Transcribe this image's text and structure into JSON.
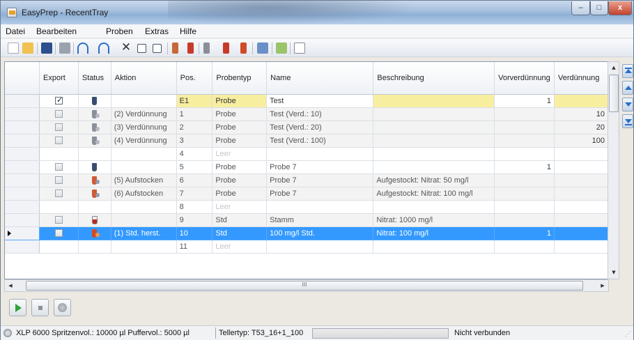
{
  "window": {
    "title": "EasyPrep - RecentTray",
    "min_label": "–",
    "max_label": "□",
    "close_label": "x"
  },
  "menu": [
    "Datei",
    "Bearbeiten",
    "Proben",
    "Extras",
    "Hilfe"
  ],
  "toolbar": {
    "icons": [
      "new-icon",
      "open-icon",
      "save-icon",
      "print-icon",
      "undo-icon",
      "redo-icon",
      "delete-icon",
      "check-all-icon",
      "uncheck-all-icon",
      "dilution-icon",
      "spike-icon",
      "dilution-dropdown-icon",
      "spike-dropdown-icon",
      "standard-icon",
      "table-icon",
      "import-icon",
      "list-icon"
    ]
  },
  "grid": {
    "columns": [
      "Export",
      "Status",
      "Aktion",
      "Pos.",
      "Probentyp",
      "Name",
      "Beschreibung",
      "Vorverdünnung",
      "Verdünnung"
    ],
    "rows": [
      {
        "export": true,
        "status": "vial",
        "aktion": "",
        "pos": "E1",
        "typ": "Probe",
        "name": "Test",
        "beschreibung": "",
        "vorverd": "1",
        "verd": "",
        "style": "yellow"
      },
      {
        "export": false,
        "status": "vial-dil",
        "aktion": "(2) Verdünnung",
        "pos": "1",
        "typ": "Probe",
        "name": "Test (Verd.: 10)",
        "beschreibung": "",
        "vorverd": "",
        "verd": "10",
        "style": "gray"
      },
      {
        "export": false,
        "status": "vial-dil",
        "aktion": "(3) Verdünnung",
        "pos": "2",
        "typ": "Probe",
        "name": "Test (Verd.: 20)",
        "beschreibung": "",
        "vorverd": "",
        "verd": "20",
        "style": "gray"
      },
      {
        "export": false,
        "status": "vial-dil",
        "aktion": "(4) Verdünnung",
        "pos": "3",
        "typ": "Probe",
        "name": "Test (Verd.: 100)",
        "beschreibung": "",
        "vorverd": "",
        "verd": "100",
        "style": "gray"
      },
      {
        "export": null,
        "status": "",
        "aktion": "",
        "pos": "4",
        "typ": "Leer",
        "name": "",
        "beschreibung": "",
        "vorverd": "",
        "verd": "",
        "style": "empty"
      },
      {
        "export": false,
        "status": "vial",
        "aktion": "",
        "pos": "5",
        "typ": "Probe",
        "name": "Probe 7",
        "beschreibung": "",
        "vorverd": "1",
        "verd": "",
        "style": "white"
      },
      {
        "export": false,
        "status": "spike",
        "aktion": "(5) Aufstocken",
        "pos": "6",
        "typ": "Probe",
        "name": "Probe 7",
        "beschreibung": "Aufgestockt: Nitrat: 50 mg/l",
        "vorverd": "",
        "verd": "",
        "style": "gray"
      },
      {
        "export": false,
        "status": "spike",
        "aktion": "(6) Aufstocken",
        "pos": "7",
        "typ": "Probe",
        "name": "Probe 7",
        "beschreibung": "Aufgestockt: Nitrat: 100 mg/l",
        "vorverd": "",
        "verd": "",
        "style": "gray"
      },
      {
        "export": null,
        "status": "",
        "aktion": "",
        "pos": "8",
        "typ": "Leer",
        "name": "",
        "beschreibung": "",
        "vorverd": "",
        "verd": "",
        "style": "empty"
      },
      {
        "export": false,
        "status": "flask",
        "aktion": "",
        "pos": "9",
        "typ": "Std",
        "name": "Stamm",
        "beschreibung": "Nitrat: 1000 mg/l",
        "vorverd": "",
        "verd": "",
        "style": "gray"
      },
      {
        "export": false,
        "status": "std",
        "aktion": "(1) Std. herst.",
        "pos": "10",
        "typ": "Std",
        "name": "100 mg/l Std.",
        "beschreibung": "Nitrat: 100 mg/l",
        "vorverd": "1",
        "verd": "",
        "style": "selected"
      },
      {
        "export": null,
        "status": "",
        "aktion": "",
        "pos": "11",
        "typ": "Leer",
        "name": "",
        "beschreibung": "",
        "vorverd": "",
        "verd": "",
        "style": "empty"
      }
    ]
  },
  "hscroll": {
    "thumb_label": "III"
  },
  "status": {
    "device": "XLP 6000 Spritzenvol.: 10000 µl  Puffervol.: 5000 µl",
    "tray": "Tellertyp: T53_16+1_100",
    "connection": "Nicht verbunden"
  }
}
